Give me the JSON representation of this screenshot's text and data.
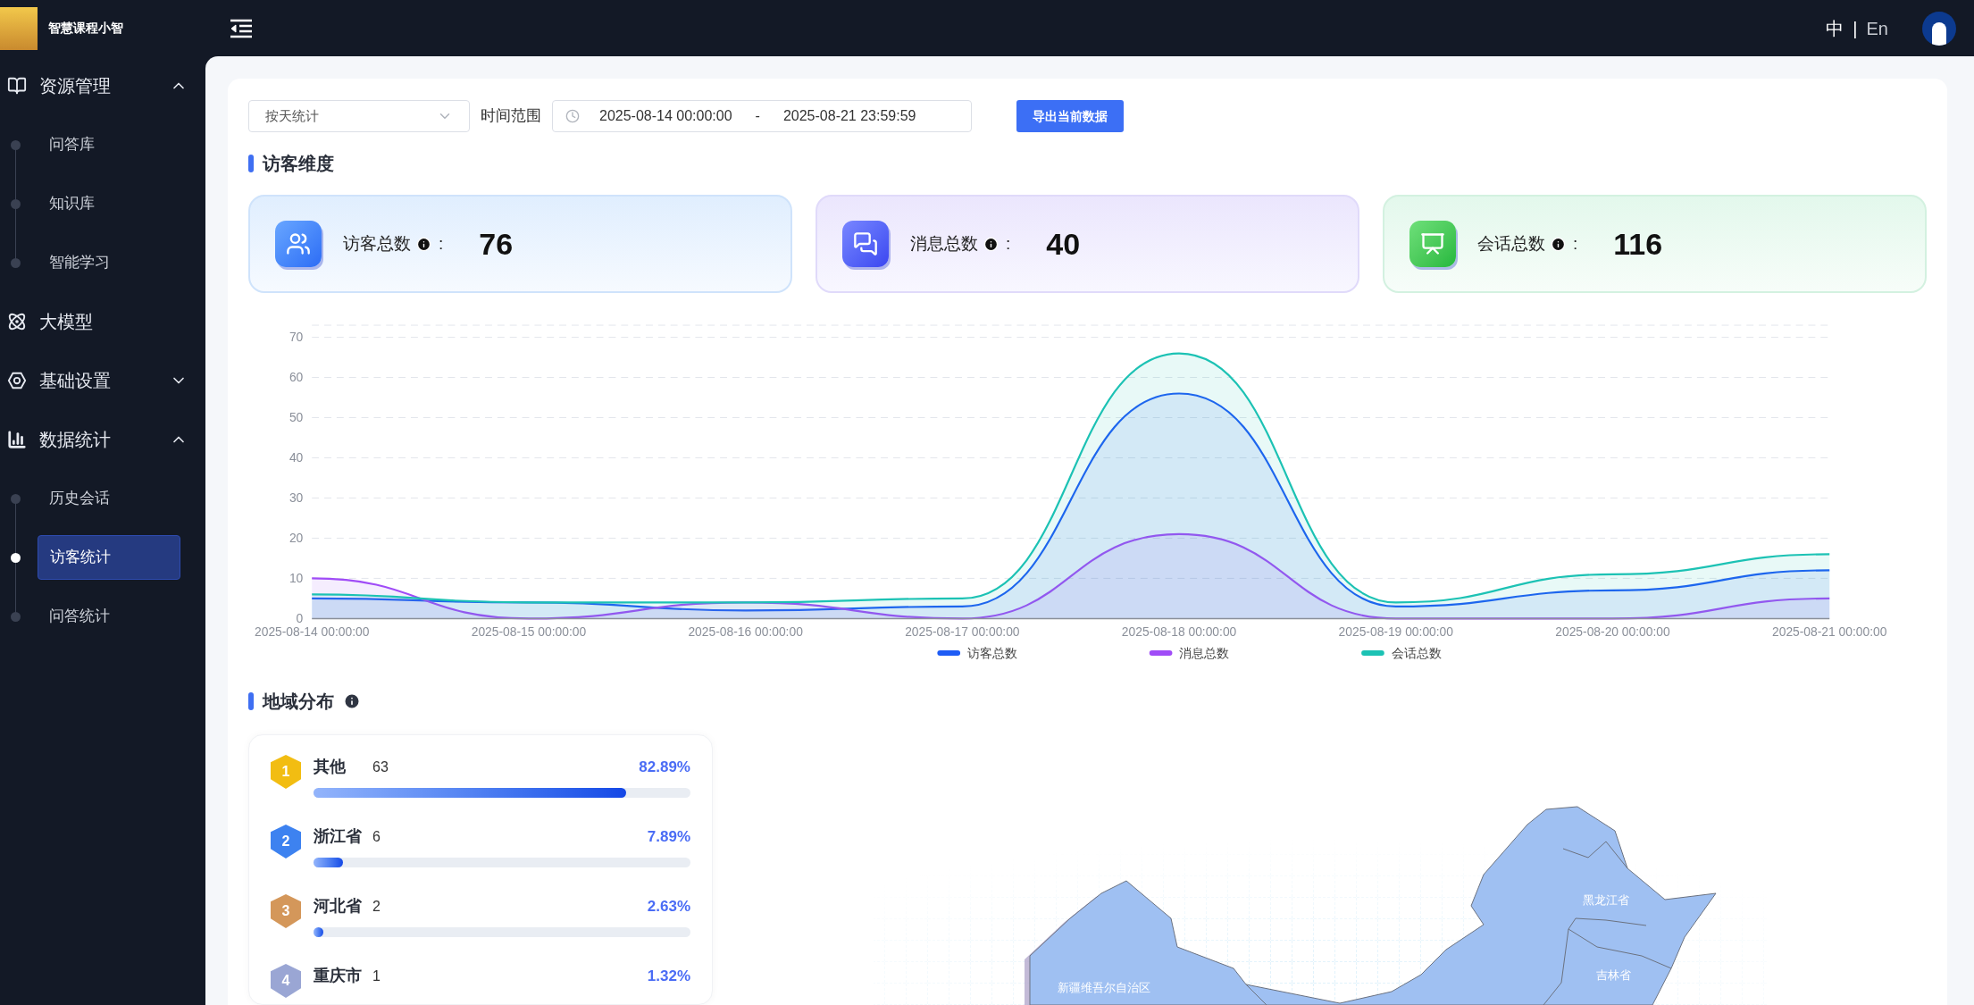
{
  "app": {
    "title": "智慧课程小智"
  },
  "header": {
    "languages": [
      {
        "label": "中",
        "selected": true
      },
      {
        "label": "En",
        "selected": false
      }
    ],
    "separator": "|"
  },
  "sidebar": {
    "items": [
      {
        "label": "资源管理",
        "kind": "group",
        "expanded": true,
        "children": [
          {
            "label": "问答库",
            "selected": false
          },
          {
            "label": "知识库",
            "selected": false
          },
          {
            "label": "智能学习",
            "selected": false
          }
        ]
      },
      {
        "label": "大模型",
        "kind": "link"
      },
      {
        "label": "基础设置",
        "kind": "group",
        "expanded": false
      },
      {
        "label": "数据统计",
        "kind": "group",
        "expanded": true,
        "children": [
          {
            "label": "历史会话",
            "selected": false
          },
          {
            "label": "访客统计",
            "selected": true
          },
          {
            "label": "问答统计",
            "selected": false
          }
        ]
      }
    ]
  },
  "filters": {
    "granularity": {
      "value": "按天统计"
    },
    "range_label": "时间范围",
    "start": "2025-08-14 00:00:00",
    "separator": "-",
    "end": "2025-08-21 23:59:59",
    "export_button": "导出当前数据"
  },
  "visitor_section": {
    "title": "访客维度",
    "cards": [
      {
        "label": "访客总数",
        "colon": ":",
        "value": "76"
      },
      {
        "label": "消息总数",
        "colon": ":",
        "value": "40"
      },
      {
        "label": "会话总数",
        "colon": ":",
        "value": "116"
      }
    ],
    "chart_data": {
      "type": "area",
      "categories": [
        "2025-08-14 00:00:00",
        "2025-08-15 00:00:00",
        "2025-08-16 00:00:00",
        "2025-08-17 00:00:00",
        "2025-08-18 00:00:00",
        "2025-08-19 00:00:00",
        "2025-08-20 00:00:00",
        "2025-08-21 00:00:00"
      ],
      "series": [
        {
          "name": "访客总数",
          "color": "#1e5cf5",
          "values": [
            5,
            4,
            2,
            3,
            56,
            3,
            7,
            12
          ]
        },
        {
          "name": "消息总数",
          "color": "#a04cf7",
          "values": [
            10,
            0,
            4,
            0,
            21,
            0,
            0,
            5
          ]
        },
        {
          "name": "会话总数",
          "color": "#1cc2b4",
          "values": [
            6,
            4,
            4,
            5,
            66,
            4,
            11,
            16
          ]
        }
      ],
      "ylim": [
        0,
        73
      ],
      "grid": true,
      "legend": "bottom",
      "yticks": [
        0,
        10,
        20,
        30,
        40,
        50,
        60,
        70
      ]
    }
  },
  "region_section": {
    "title": "地域分布",
    "ranking": [
      {
        "rank": "1",
        "name": "其他",
        "count": "63",
        "percent": "82.89%",
        "level": 0.8289,
        "color": "#f2bd12"
      },
      {
        "rank": "2",
        "name": "浙江省",
        "count": "6",
        "percent": "7.89%",
        "level": 0.0789,
        "color": "#3d82f0"
      },
      {
        "rank": "3",
        "name": "河北省",
        "count": "2",
        "percent": "2.63%",
        "level": 0.0263,
        "color": "#d4975a"
      },
      {
        "rank": "4",
        "name": "重庆市",
        "count": "1",
        "percent": "1.32%",
        "color": "#9aa6d4"
      }
    ],
    "map": {
      "labels": [
        "黑龙江省",
        "吉林省",
        "新疆维吾尔自治区"
      ]
    }
  }
}
